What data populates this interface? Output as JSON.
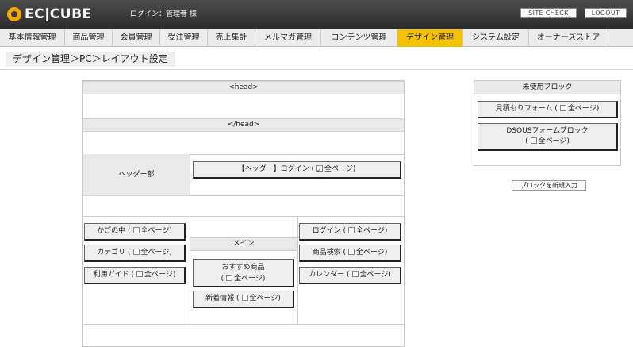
{
  "header": {
    "logo": "EC|CUBE",
    "login_info": "ログイン：管理者 様",
    "site_check": "SITE CHECK",
    "logout": "LOGOUT"
  },
  "nav": {
    "items": [
      {
        "label": "基本情報管理"
      },
      {
        "label": "商品管理"
      },
      {
        "label": "会員管理"
      },
      {
        "label": "受注管理"
      },
      {
        "label": "売上集計"
      },
      {
        "label": "メルマガ管理"
      },
      {
        "label": "コンテンツ管理"
      },
      {
        "label": "デザイン管理",
        "active": true
      },
      {
        "label": "システム設定"
      },
      {
        "label": "オーナーズストア"
      }
    ],
    "active_color": "#f6c200"
  },
  "breadcrumb": "デザイン管理＞PC＞レイアウト設定",
  "layout": {
    "head_open": "<head>",
    "head_close": "</head>",
    "header_section": "ヘッダー部",
    "main_label": "メイン",
    "all_pages": "全ページ",
    "header_blocks": [
      {
        "name": "【ヘッダー】ログイン",
        "all_pages_checked": true
      }
    ],
    "left_blocks": [
      {
        "name": "かごの中",
        "all_pages_checked": false
      },
      {
        "name": "カテゴリ",
        "all_pages_checked": false
      },
      {
        "name": "利用ガイド",
        "all_pages_checked": false
      }
    ],
    "main_blocks": [
      {
        "name": "おすすめ商品",
        "all_pages_checked": false
      },
      {
        "name": "新着情報",
        "all_pages_checked": false
      }
    ],
    "right_blocks": [
      {
        "name": "ログイン",
        "all_pages_checked": false
      },
      {
        "name": "商品検索",
        "all_pages_checked": false
      },
      {
        "name": "カレンダー",
        "all_pages_checked": false
      }
    ]
  },
  "unused": {
    "title": "未使用ブロック",
    "blocks": [
      {
        "name": "見積もりフォーム",
        "all_pages_checked": false
      },
      {
        "name": "DSQUSフォームブロック",
        "all_pages_checked": false
      }
    ]
  },
  "new_block_button": "ブロックを新規入力"
}
